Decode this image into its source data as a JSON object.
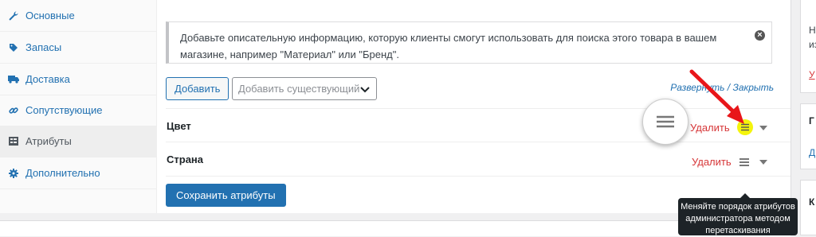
{
  "tabs": [
    {
      "label": "Основные",
      "icon": "wrench-icon"
    },
    {
      "label": "Запасы",
      "icon": "tag-icon"
    },
    {
      "label": "Доставка",
      "icon": "truck-icon"
    },
    {
      "label": "Сопутствующие",
      "icon": "link-icon"
    },
    {
      "label": "Атрибуты",
      "icon": "list-icon",
      "active": true
    },
    {
      "label": "Дополнительно",
      "icon": "gear-icon"
    }
  ],
  "notice": {
    "text": "Добавьте описательную информацию, которую клиенты смогут использовать для поиска этого товара в вашем магазине, например \"Материал\" или \"Бренд\"."
  },
  "toolbar": {
    "add_label": "Добавить",
    "existing_placeholder": "Добавить существующий",
    "expand_label": "Развернуть",
    "separator": " / ",
    "collapse_label": "Закрыть"
  },
  "attributes": [
    {
      "name": "Цвет",
      "delete_label": "Удалить"
    },
    {
      "name": "Страна",
      "delete_label": "Удалить"
    }
  ],
  "save_label": "Сохранить атрибуты",
  "tooltip": {
    "text": "Меняйте порядок атрибутов администратора методом перетаскивания"
  },
  "sidebar_right": {
    "line1": "Н",
    "line2": "из",
    "link1": "У",
    "box2_title": "Г",
    "box2_link": "Д",
    "box3_title": "К"
  },
  "colors": {
    "accent": "#2271b1",
    "delete": "#d63638",
    "highlight": "#f4f40c",
    "annotation_arrow": "#e8161a"
  }
}
